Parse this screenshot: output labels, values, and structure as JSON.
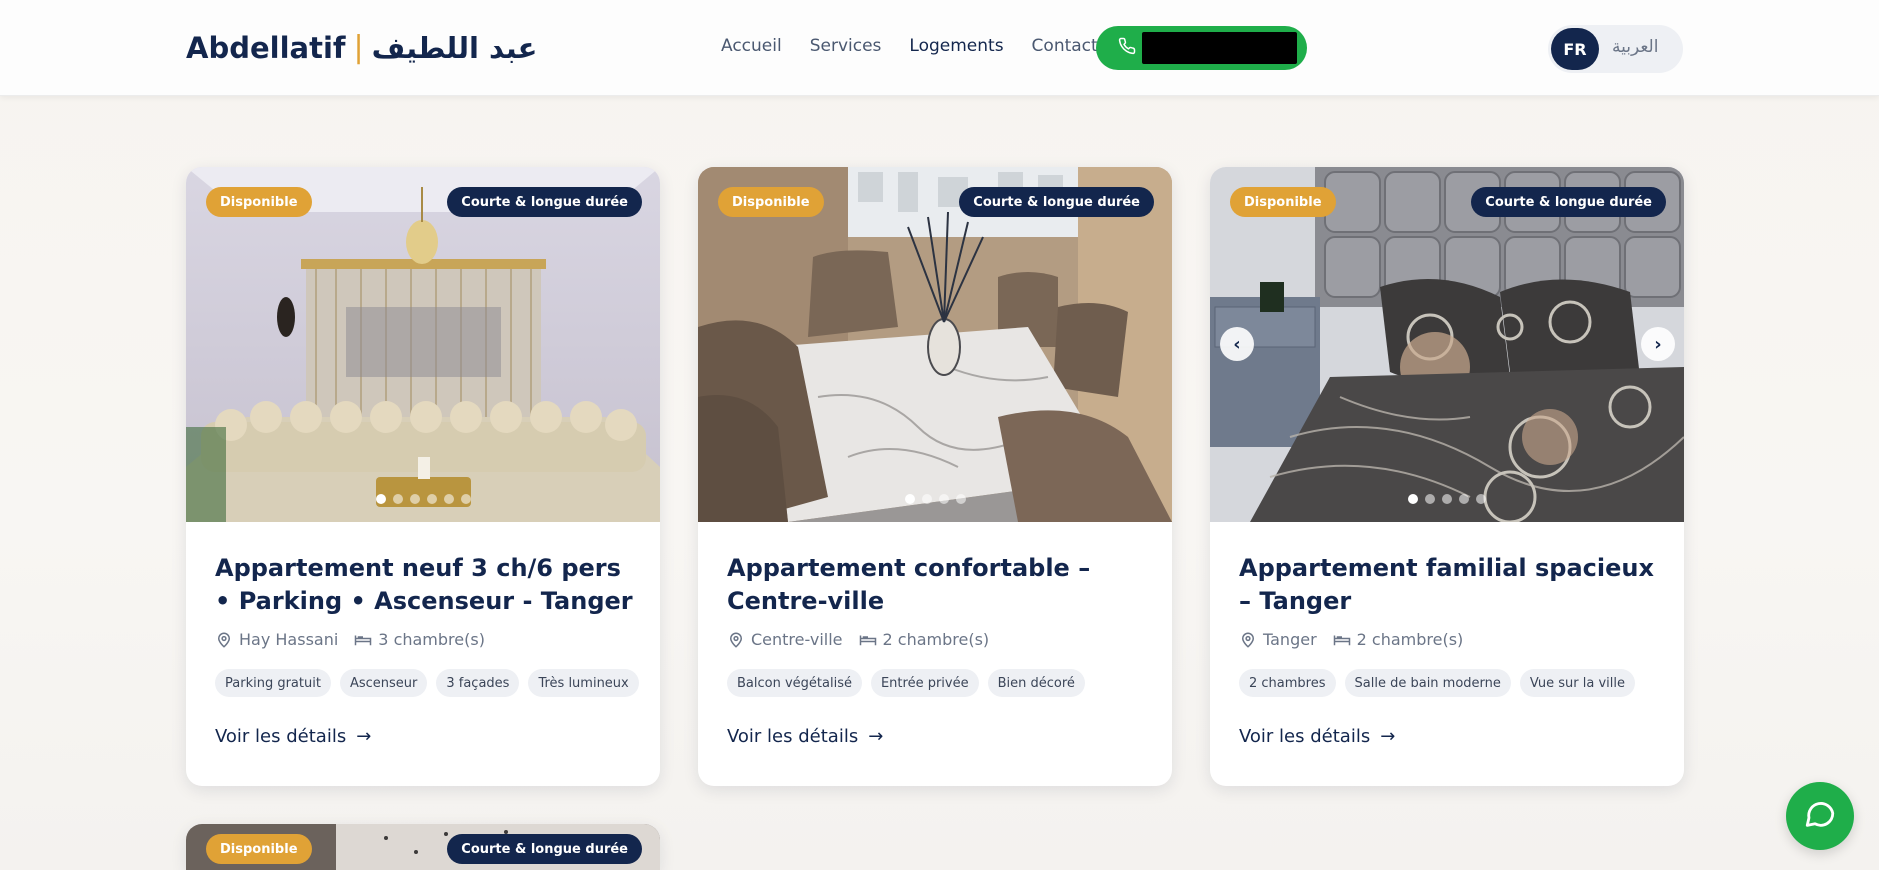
{
  "header": {
    "brand_latin": "Abdellatif",
    "brand_sep": "|",
    "brand_arabic": "عبد اللطيف",
    "nav": [
      "Accueil",
      "Services",
      "Logements",
      "Contact"
    ],
    "nav_active": "Logements",
    "lang_fr": "FR",
    "lang_ar": "العربية"
  },
  "listings": [
    {
      "badge_status": "Disponible",
      "badge_term": "Courte & longue durée",
      "title": "Appartement neuf 3 ch/6 pers • Parking • Ascenseur - Tanger",
      "location": "Hay Hassani",
      "rooms": "3 chambre(s)",
      "tags": [
        "Parking gratuit",
        "Ascenseur",
        "3 façades",
        "Très lumineux"
      ],
      "cta": "Voir les détails",
      "photo_count": 6,
      "photo_active": 1
    },
    {
      "badge_status": "Disponible",
      "badge_term": "Courte & longue durée",
      "title": "Appartement confortable – Centre-ville",
      "location": "Centre-ville",
      "rooms": "2 chambre(s)",
      "tags": [
        "Balcon végétalisé",
        "Entrée privée",
        "Bien décoré"
      ],
      "cta": "Voir les détails",
      "photo_count": 4,
      "photo_active": 1
    },
    {
      "badge_status": "Disponible",
      "badge_term": "Courte & longue durée",
      "title": "Appartement familial spacieux – Tanger",
      "location": "Tanger",
      "rooms": "2 chambre(s)",
      "tags": [
        "2 chambres",
        "Salle de bain moderne",
        "Vue sur la ville"
      ],
      "cta": "Voir les détails",
      "photo_count": 5,
      "photo_active": 1
    },
    {
      "badge_status": "Disponible",
      "badge_term": "Courte & longue durée"
    }
  ],
  "colors": {
    "navy": "#13264d",
    "gold": "#e0a236",
    "green": "#1fae4a"
  }
}
